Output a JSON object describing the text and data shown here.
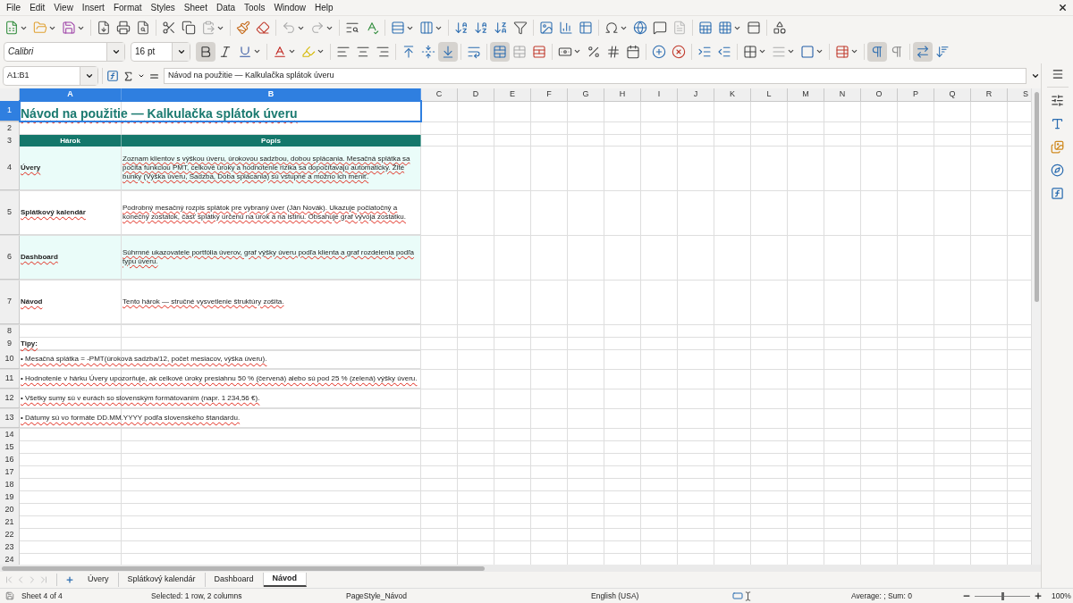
{
  "menu": [
    "File",
    "Edit",
    "View",
    "Insert",
    "Format",
    "Styles",
    "Sheet",
    "Data",
    "Tools",
    "Window",
    "Help"
  ],
  "format_toolbar": {
    "font_name": "Calibri",
    "font_size": "16 pt",
    "pressed": {
      "bold": true,
      "align_bottom": true,
      "merge_center": true,
      "ltr": true,
      "wrap_direction": true
    }
  },
  "formula_bar": {
    "name_box": "A1:B1",
    "formula": "Návod na použitie — Kalkulačka splátok úveru"
  },
  "columns": [
    {
      "label": "A",
      "selected": true
    },
    {
      "label": "B",
      "selected": true
    },
    {
      "label": "C",
      "selected": false
    },
    {
      "label": "D",
      "selected": false
    },
    {
      "label": "E",
      "selected": false
    },
    {
      "label": "F",
      "selected": false
    },
    {
      "label": "G",
      "selected": false
    },
    {
      "label": "H",
      "selected": false
    },
    {
      "label": "I",
      "selected": false
    },
    {
      "label": "J",
      "selected": false
    },
    {
      "label": "K",
      "selected": false
    },
    {
      "label": "L",
      "selected": false
    },
    {
      "label": "M",
      "selected": false
    },
    {
      "label": "N",
      "selected": false
    },
    {
      "label": "O",
      "selected": false
    },
    {
      "label": "P",
      "selected": false
    },
    {
      "label": "Q",
      "selected": false
    },
    {
      "label": "R",
      "selected": false
    },
    {
      "label": "S",
      "selected": false
    }
  ],
  "rows": [
    {
      "number": "1",
      "selected": true,
      "kind": "title",
      "text": "Návod na použitie — Kalkulačka splátok úveru"
    },
    {
      "number": "2",
      "selected": false,
      "kind": "blank"
    },
    {
      "number": "3",
      "selected": false,
      "kind": "header",
      "cells": [
        "Hárok",
        "Popis"
      ]
    },
    {
      "number": "4",
      "selected": false,
      "kind": "entry",
      "shaded": true,
      "sheet": "Úvery",
      "description": "Zoznam klientov s výškou úveru, úrokovou sadzbou, dobou splácania. Mesačná splátka sa počíta funkciou PMT, celkové úroky a hodnotenie rizika sa dopočítavajú automaticky. Žlté bunky (Výška úveru, Sadzba, Doba splácania) sú vstupné a možno ich meniť."
    },
    {
      "number": "5",
      "selected": false,
      "kind": "entry",
      "shaded": false,
      "sheet": "Splátkový kalendár",
      "description": "Podrobný mesačný rozpis splátok pre vybraný úver (Ján Novák). Ukazuje počiatočný a konečný zostatok, časť splátky určenú na úrok a na istinu. Obsahuje graf vývoja zostatku."
    },
    {
      "number": "6",
      "selected": false,
      "kind": "entry",
      "shaded": true,
      "sheet": "Dashboard",
      "description": "Súhrnné ukazovatele portfólia úverov, graf výšky úveru podľa klienta a graf rozdelenia podľa typu úveru."
    },
    {
      "number": "7",
      "selected": false,
      "kind": "entry",
      "shaded": false,
      "sheet": "Návod",
      "description": "Tento hárok — stručné vysvetlenie štruktúry zošita."
    },
    {
      "number": "8",
      "selected": false,
      "kind": "blank"
    },
    {
      "number": "9",
      "selected": false,
      "kind": "label",
      "text": "Tipy:"
    },
    {
      "number": "10",
      "selected": false,
      "kind": "tip",
      "text": "• Mesačná splátka = -PMT(úroková sadzba/12, počet mesiacov, výška úveru)."
    },
    {
      "number": "11",
      "selected": false,
      "kind": "tip",
      "text": "• Hodnotenie v hárku Úvery upozorňuje, ak celkové úroky presiahnu 50 % (červená) alebo sú pod 25 % (zelená) výšky úveru."
    },
    {
      "number": "12",
      "selected": false,
      "kind": "tip",
      "text": "• Všetky sumy sú v eurách so slovenským formátovaním (napr. 1 234,56 €)."
    },
    {
      "number": "13",
      "selected": false,
      "kind": "tip",
      "text": "• Dátumy sú vo formáte DD.MM.YYYY podľa slovenského štandardu."
    },
    {
      "number": "14",
      "selected": false,
      "kind": "blank"
    },
    {
      "number": "15",
      "selected": false,
      "kind": "blank"
    },
    {
      "number": "16",
      "selected": false,
      "kind": "blank"
    },
    {
      "number": "17",
      "selected": false,
      "kind": "blank"
    },
    {
      "number": "18",
      "selected": false,
      "kind": "blank"
    },
    {
      "number": "19",
      "selected": false,
      "kind": "blank"
    },
    {
      "number": "20",
      "selected": false,
      "kind": "blank"
    },
    {
      "number": "21",
      "selected": false,
      "kind": "blank"
    },
    {
      "number": "22",
      "selected": false,
      "kind": "blank"
    },
    {
      "number": "23",
      "selected": false,
      "kind": "blank"
    },
    {
      "number": "24",
      "selected": false,
      "kind": "blank"
    }
  ],
  "sheet_tabs": [
    {
      "label": "Úvery",
      "selected": false
    },
    {
      "label": "Splátkový kalendár",
      "selected": false
    },
    {
      "label": "Dashboard",
      "selected": false
    },
    {
      "label": "Návod",
      "selected": true
    }
  ],
  "status_bar": {
    "sheet": "Sheet 4 of 4",
    "selection": "Selected: 1 row, 2 columns",
    "page_style": "PageStyle_Návod",
    "language": "English (USA)",
    "sum": "Average: ; Sum: 0",
    "zoom_slider": {
      "level": 0.5
    },
    "zoom": "100%"
  }
}
